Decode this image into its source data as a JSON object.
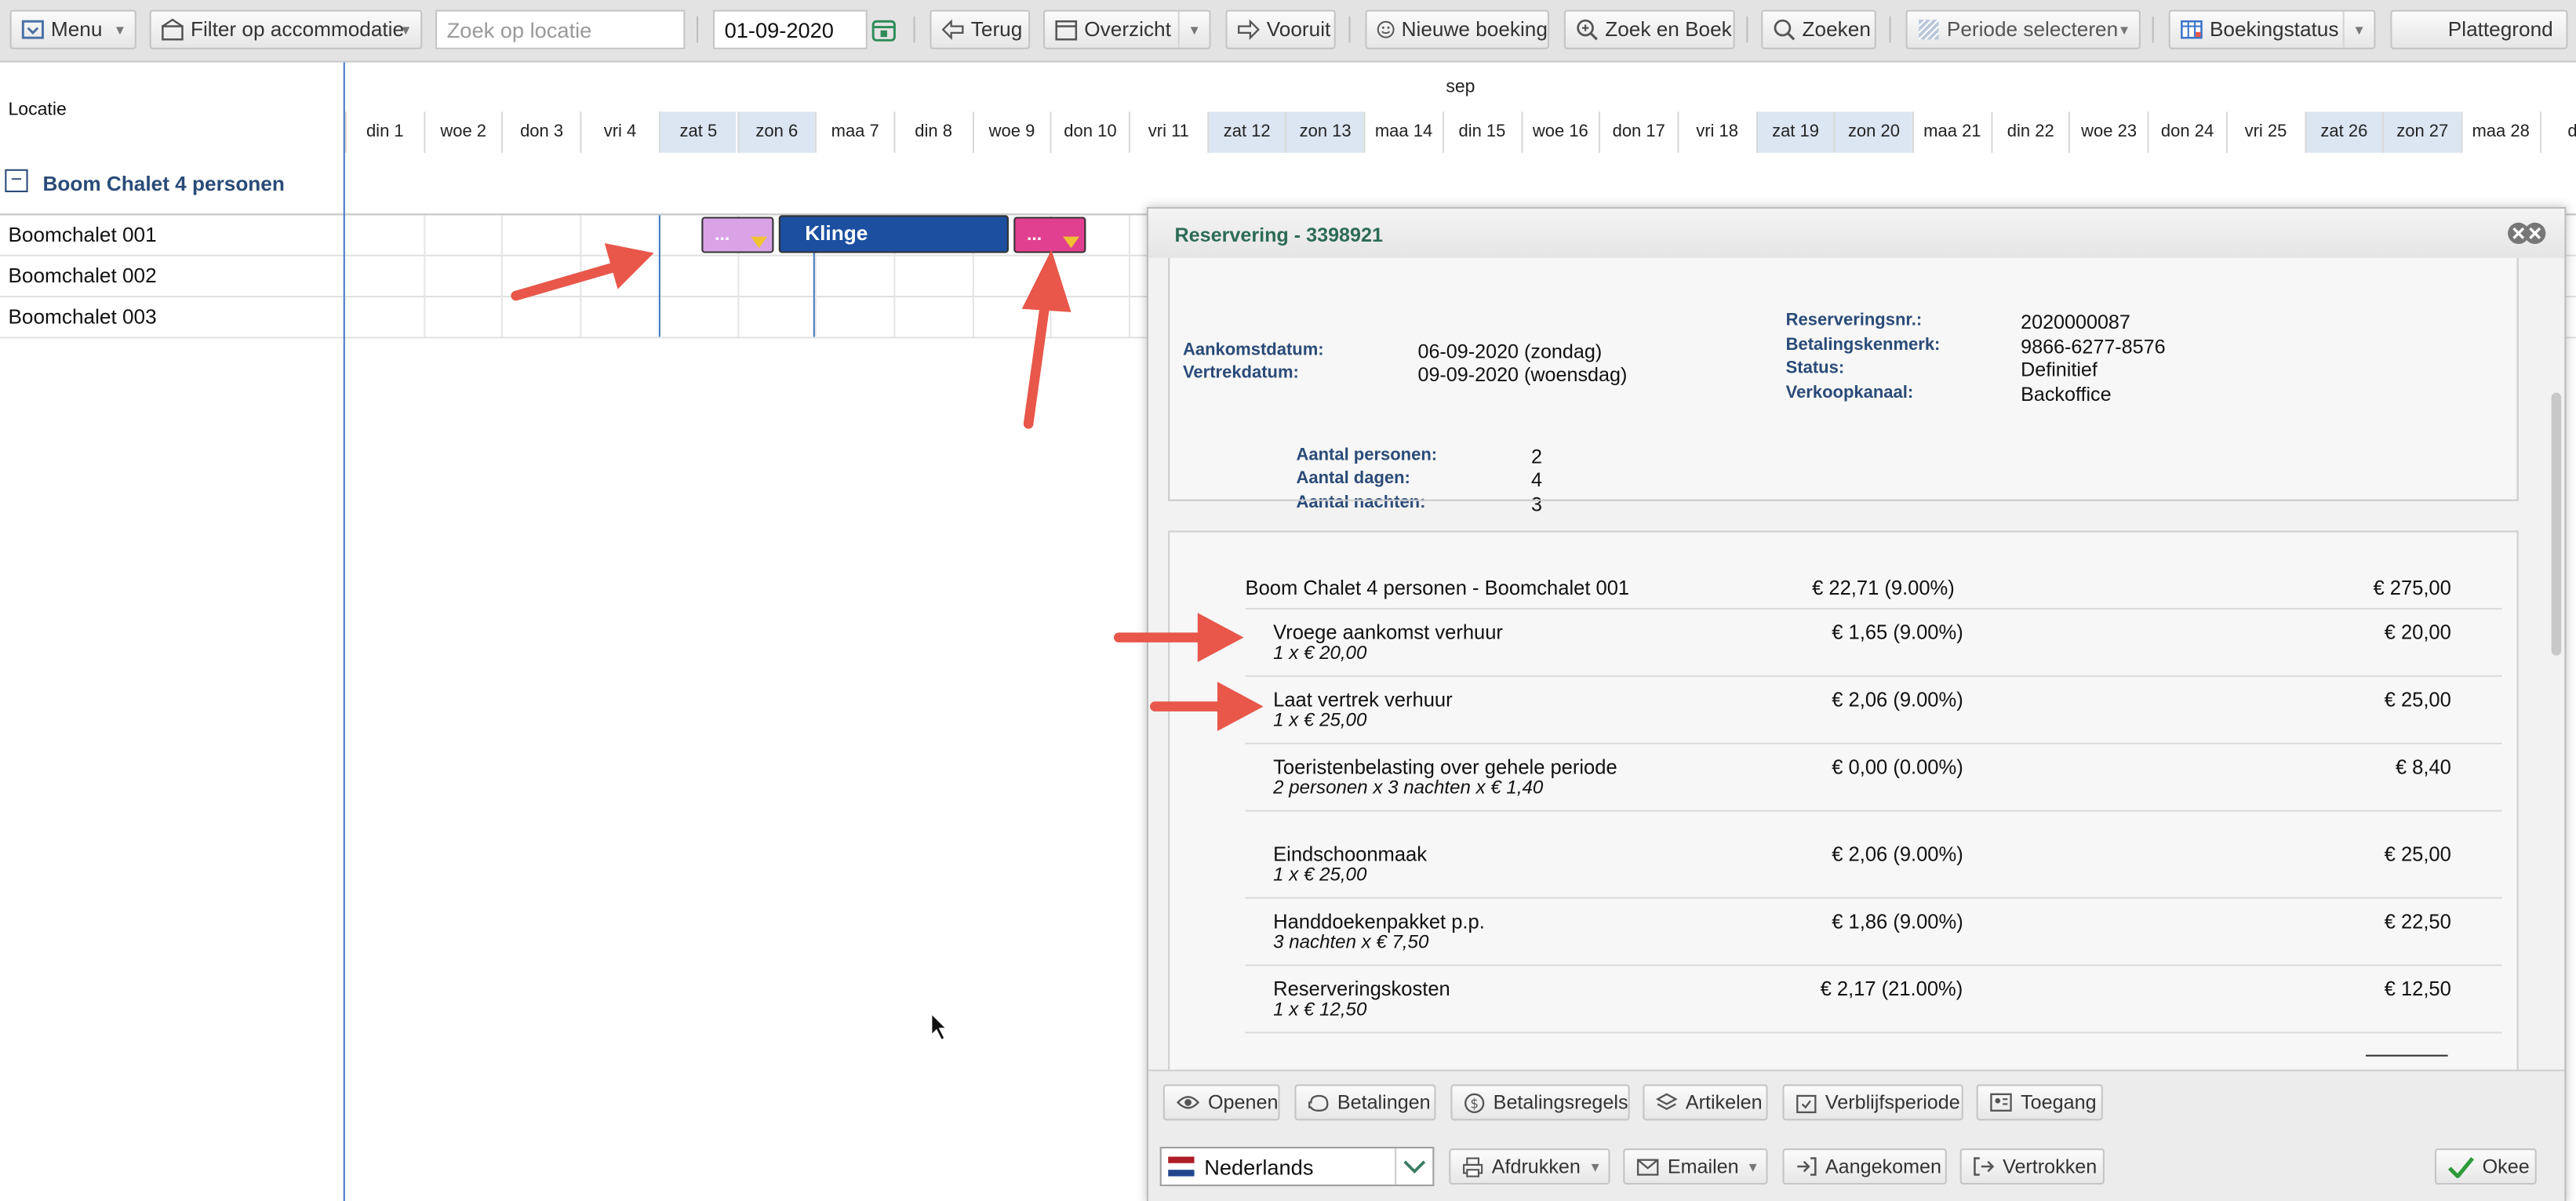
{
  "toolbar": {
    "menu": "Menu",
    "filter": "Filter op accommodatie",
    "search_placeholder": "Zoek op locatie",
    "date": "01-09-2020",
    "back": "Terug",
    "overview": "Overzicht",
    "forward": "Vooruit",
    "new_booking": "Nieuwe boeking",
    "search_book": "Zoek en Boek",
    "search": "Zoeken",
    "select_period": "Periode selecteren",
    "booking_status": "Boekingstatus",
    "floor_plan": "Plattegrond"
  },
  "grid": {
    "location_header": "Locatie",
    "month": "sep",
    "days": [
      "din 1",
      "woe 2",
      "don 3",
      "vri 4",
      "zat 5",
      "zon 6",
      "maa 7",
      "din 8",
      "woe 9",
      "don 10",
      "vri 11",
      "zat 12",
      "zon 13",
      "maa 14",
      "din 15",
      "woe 16",
      "don 17",
      "vri 18",
      "zat 19",
      "zon 20",
      "maa 21",
      "din 22",
      "woe 23",
      "don 24",
      "vri 25",
      "zat 26",
      "zon 27",
      "maa 28",
      "din"
    ],
    "group": "Boom Chalet 4 personen",
    "rows": [
      "Boomchalet 001",
      "Boomchalet 002",
      "Boomchalet 003"
    ],
    "bookings": {
      "left_label": "...",
      "main_label": "Klinge",
      "right_label": "..."
    }
  },
  "dialog": {
    "title": "Reservering - 3398921",
    "arrival_label": "Aankomstdatum:",
    "arrival_value": "06-09-2020 (zondag)",
    "departure_label": "Vertrekdatum:",
    "departure_value": "09-09-2020 (woensdag)",
    "resnr_label": "Reserveringsnr.:",
    "resnr_value": "2020000087",
    "payref_label": "Betalingskenmerk:",
    "payref_value": "9866-6277-8576",
    "status_label": "Status:",
    "status_value": "Definitief",
    "channel_label": "Verkoopkanaal:",
    "channel_value": "Backoffice",
    "persons_label": "Aantal personen:",
    "persons_value": "2",
    "days_label": "Aantal dagen:",
    "days_value": "4",
    "nights_label": "Aantal nachten:",
    "nights_value": "3",
    "main_line": {
      "name": "Boom Chalet 4 personen - Boomchalet 001",
      "vat": "€ 22,71 (9.00%)",
      "amount": "€ 275,00"
    },
    "lines": [
      {
        "name": "Vroege aankomst verhuur",
        "sub": "1 x € 20,00",
        "vat": "€ 1,65 (9.00%)",
        "amount": "€ 20,00"
      },
      {
        "name": "Laat vertrek verhuur",
        "sub": "1 x € 25,00",
        "vat": "€ 2,06 (9.00%)",
        "amount": "€ 25,00"
      },
      {
        "name": "Toeristenbelasting over gehele periode",
        "sub": "2 personen x 3 nachten x € 1,40",
        "vat": "€ 0,00 (0.00%)",
        "amount": "€ 8,40"
      },
      {
        "name": "Eindschoonmaak",
        "sub": "1 x € 25,00",
        "vat": "€ 2,06 (9.00%)",
        "amount": "€ 25,00"
      },
      {
        "name": "Handdoekenpakket p.p.",
        "sub": "3 nachten x € 7,50",
        "vat": "€ 1,86 (9.00%)",
        "amount": "€ 22,50"
      },
      {
        "name": "Reserveringskosten",
        "sub": "1 x € 12,50",
        "vat": "€ 2,17 (21.00%)",
        "amount": "€ 12,50"
      }
    ],
    "buttons": {
      "open": "Openen",
      "payments": "Betalingen",
      "payment_rules": "Betalingsregels",
      "articles": "Artikelen",
      "stay_period": "Verblijfsperiode",
      "access": "Toegang",
      "language": "Nederlands",
      "print": "Afdrukken",
      "email": "Emailen",
      "arrived": "Aangekomen",
      "departed": "Vertrokken",
      "ok": "Okee"
    }
  },
  "colors": {
    "booking_main": "#1c4fa0",
    "booking_left": "#d9a3e6",
    "booking_right": "#e0408f",
    "weekend": "#dce6f2",
    "arrow": "#e8574a"
  }
}
